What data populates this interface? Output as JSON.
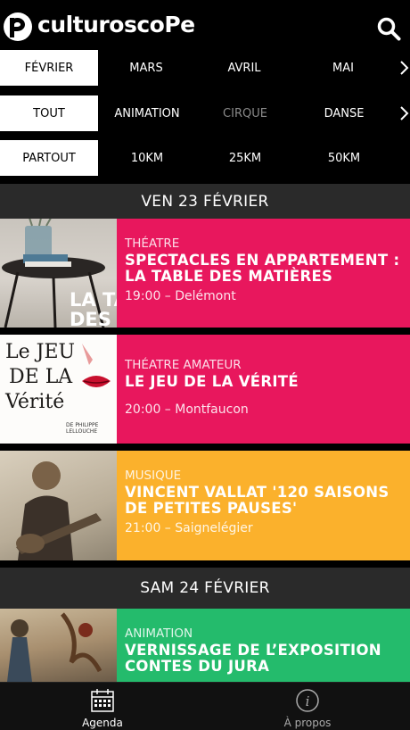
{
  "app": {
    "logo_text": "culturoscoPe"
  },
  "months": [
    {
      "label": "FÉVRIER",
      "active": true
    },
    {
      "label": "MARS",
      "active": false
    },
    {
      "label": "AVRIL",
      "active": false
    },
    {
      "label": "MAI",
      "active": false
    }
  ],
  "categories": [
    {
      "label": "TOUT",
      "active": true
    },
    {
      "label": "ANIMATION",
      "active": false
    },
    {
      "label": "CIRQUE",
      "active": false,
      "dim": true
    },
    {
      "label": "DANSE",
      "active": false
    }
  ],
  "distances": [
    {
      "label": "PARTOUT",
      "active": true
    },
    {
      "label": "10KM",
      "active": false
    },
    {
      "label": "25KM",
      "active": false
    },
    {
      "label": "50KM",
      "active": false
    }
  ],
  "days": [
    {
      "label": "VEN 23 FÉVRIER"
    },
    {
      "label": "SAM 24 FÉVRIER"
    }
  ],
  "events": [
    {
      "category": "THÉATRE",
      "title": "SPECTACLES EN APPARTEMENT : LA TABLE DES MATIÈRES",
      "when": "19:00 – Delémont",
      "color": "#e8175d",
      "thumb_text": "LA TA\nDES M"
    },
    {
      "category": "THÉATRE AMATEUR",
      "title": "LE JEU DE LA VÉRITÉ",
      "when": "20:00 – Montfaucon",
      "color": "#e8175d",
      "thumb_lines": [
        "Le JEU",
        "DE LA",
        "Vérité"
      ],
      "thumb_small": "DE PHILIPPE LELLOUCHE"
    },
    {
      "category": "MUSIQUE",
      "title": "VINCENT VALLAT '120 SAISONS DE PETITES PAUSES'",
      "when": "21:00 – Saignelégier",
      "color": "#fbb12c"
    },
    {
      "category": "ANIMATION",
      "title": "VERNISSAGE DE L’EXPOSITION CONTES DU JURA",
      "when": "",
      "color": "#24bb6c"
    }
  ],
  "tabs": [
    {
      "label": "Agenda",
      "icon": "calendar-icon",
      "active": true
    },
    {
      "label": "À propos",
      "icon": "info-icon",
      "active": false
    }
  ]
}
